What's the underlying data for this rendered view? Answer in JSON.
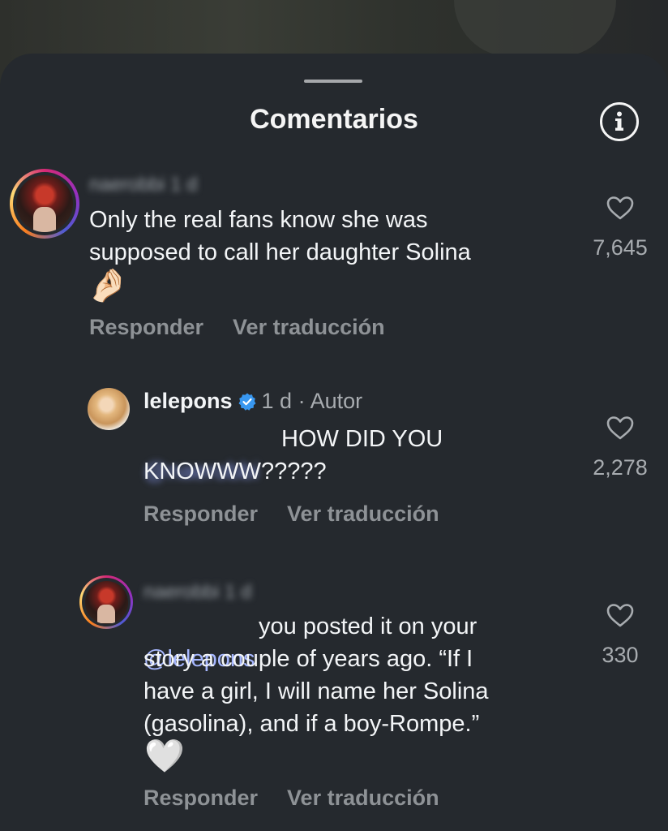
{
  "sheet": {
    "title": "Comentarios",
    "info_icon": "info-icon"
  },
  "comments": [
    {
      "username": "naerobbi",
      "time": "1 d",
      "text": "Only the real fans know she was\nsupposed to call her daughter Solina",
      "emoji": "🤌🏻",
      "likes": "7,645",
      "reply_label": "Responder",
      "translate_label": "Ver traducción"
    },
    {
      "username": "lelepons",
      "verified": true,
      "meta": "1 d · Autor",
      "mention": "@naerobbi",
      "text": "HOW DID YOU\nKNOWWW?????",
      "likes": "2,278",
      "reply_label": "Responder",
      "translate_label": "Ver traducción"
    },
    {
      "username": "naerobbi",
      "time": "1 d",
      "mention": "@lelepons",
      "text": "  you posted it on your\nstory a couple of years ago. “If I\nhave a girl, I will name her Solina\n(gasolina), and if a boy-Rompe.”",
      "emoji": "🤍",
      "likes": "330",
      "reply_label": "Responder",
      "translate_label": "Ver traducción"
    }
  ],
  "colors": {
    "sheet_bg": "#25292e",
    "text": "#f3f5f7",
    "muted": "#8e9296",
    "mention": "#a6b7ff",
    "verified": "#3897f0"
  }
}
